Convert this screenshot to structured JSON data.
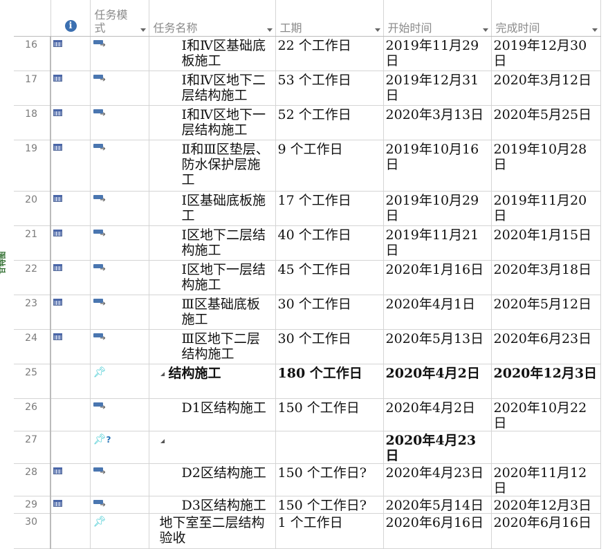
{
  "side_label": "甘特图",
  "headers": {
    "info_icon": "i",
    "mode": "任务模式",
    "name": "任务名称",
    "duration": "工期",
    "start": "开始时间",
    "finish": "完成时间"
  },
  "rows": [
    {
      "id": "16",
      "cal": true,
      "mode": "auto",
      "name": "Ⅰ和Ⅳ区基础底板施工",
      "level": 2,
      "duration": "22 个工作日",
      "start": "2019年11月29日",
      "finish": "2019年12月30日"
    },
    {
      "id": "17",
      "cal": true,
      "mode": "auto",
      "name": "Ⅰ和Ⅳ区地下二层结构施工",
      "level": 2,
      "duration": "53 个工作日",
      "start": "2019年12月31日",
      "finish": "2020年3月12日"
    },
    {
      "id": "18",
      "cal": true,
      "mode": "auto",
      "name": "Ⅰ和Ⅳ区地下一层结构施工",
      "level": 2,
      "duration": "52 个工作日",
      "start": "2020年3月13日",
      "finish": "2020年5月25日"
    },
    {
      "id": "19",
      "cal": true,
      "mode": "auto",
      "name": "Ⅱ和Ⅲ区垫层、防水保护层施工",
      "level": 2,
      "duration": "9 个工作日",
      "start": "2019年10月16日",
      "finish": "2019年10月28日"
    },
    {
      "id": "20",
      "cal": true,
      "mode": "auto",
      "name": "Ⅰ区基础底板施工",
      "level": 2,
      "duration": "17 个工作日",
      "start": "2019年10月29日",
      "finish": "2019年11月20日"
    },
    {
      "id": "21",
      "cal": true,
      "mode": "auto",
      "name": "Ⅰ区地下二层结构施工",
      "level": 2,
      "duration": "40 个工作日",
      "start": "2019年11月21日",
      "finish": "2020年1月15日"
    },
    {
      "id": "22",
      "cal": true,
      "mode": "auto",
      "name": "Ⅰ区地下一层结构施工",
      "level": 2,
      "duration": "45 个工作日",
      "start": "2020年1月16日",
      "finish": "2020年3月18日"
    },
    {
      "id": "23",
      "cal": true,
      "mode": "auto",
      "name": "Ⅲ区基础底板施工",
      "level": 2,
      "duration": "30 个工作日",
      "start": "2020年4月1日",
      "finish": "2020年5月12日"
    },
    {
      "id": "24",
      "cal": true,
      "mode": "auto",
      "name": "Ⅲ区地下二层结构施工",
      "level": 2,
      "duration": "30 个工作日",
      "start": "2020年5月13日",
      "finish": "2020年6月23日"
    },
    {
      "id": "25",
      "cal": false,
      "mode": "manual",
      "name": "结构施工",
      "level": 1,
      "summary": true,
      "bold": true,
      "duration": "180 个工作日",
      "start": "2020年4月2日",
      "finish": "2020年12月3日"
    },
    {
      "id": "26",
      "cal": false,
      "mode": "auto",
      "name": "D1区结构施工",
      "level": 2,
      "duration": "150 个工作日",
      "start": "2020年4月2日",
      "finish": "2020年10月22日"
    },
    {
      "id": "27",
      "cal": false,
      "mode": "manual-q",
      "name": "",
      "level": 1,
      "summary": true,
      "duration": "",
      "start": "2020年4月23日",
      "finish": "",
      "start_bold": true
    },
    {
      "id": "28",
      "cal": true,
      "mode": "auto",
      "name": "D2区结构施工",
      "level": 2,
      "duration": "150 个工作日?",
      "start": "2020年4月23日",
      "finish": "2020年11月12日"
    },
    {
      "id": "29",
      "cal": true,
      "mode": "auto",
      "name": "D3区结构施工",
      "level": 2,
      "duration": "150 个工作日?",
      "start": "2020年5月14日",
      "finish": "2020年12月3日"
    },
    {
      "id": "30",
      "cal": false,
      "mode": "manual",
      "name": "地下室至二层结构验收",
      "level": 0,
      "duration": "1 个工作日",
      "start": "2020年6月16日",
      "finish": "2020年6月16日"
    }
  ]
}
